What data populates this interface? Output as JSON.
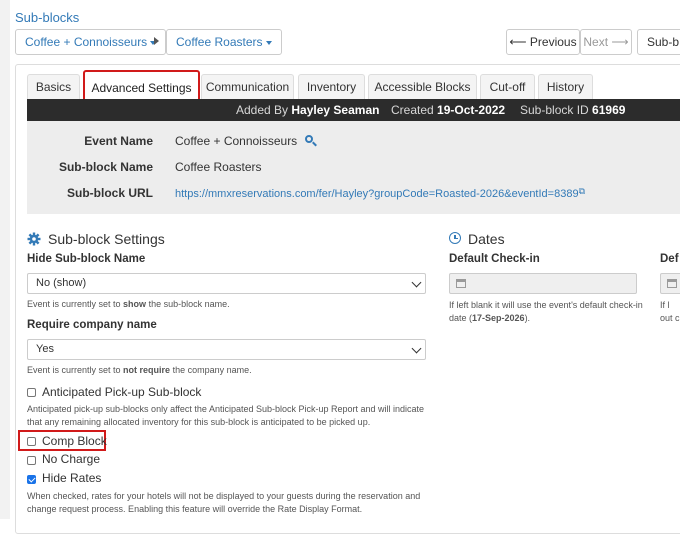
{
  "page": {
    "title": "Sub-blocks"
  },
  "breadcrumb": {
    "event": "Coffee + Connoisseurs",
    "subblock": "Coffee Roasters"
  },
  "nav": {
    "previous": "Previous",
    "next": "Next",
    "subblock_more": "Sub-b"
  },
  "tabs": [
    {
      "label": "Basics"
    },
    {
      "label": "Advanced Settings"
    },
    {
      "label": "Communication"
    },
    {
      "label": "Inventory"
    },
    {
      "label": "Accessible Blocks"
    },
    {
      "label": "Cut-off"
    },
    {
      "label": "History"
    }
  ],
  "meta": {
    "added_by_label": "Added By",
    "added_by": "Hayley Seaman",
    "created_label": "Created",
    "created": "19-Oct-2022",
    "id_label": "Sub-block ID",
    "id": "61969"
  },
  "info": {
    "event_name_label": "Event Name",
    "event_name": "Coffee + Connoisseurs",
    "subblock_name_label": "Sub-block Name",
    "subblock_name": "Coffee Roasters",
    "subblock_url_label": "Sub-block URL",
    "subblock_url": "https://mmxreservations.com/fer/Hayley?groupCode=Roasted-2026&eventId=8389"
  },
  "settings": {
    "heading": "Sub-block Settings",
    "hide_name_label": "Hide Sub-block Name",
    "hide_name_value": "No (show)",
    "hide_name_help_pre": "Event is currently set to ",
    "hide_name_help_bold": "show",
    "hide_name_help_post": " the sub-block name.",
    "require_company_label": "Require company name",
    "require_company_value": "Yes",
    "require_company_help_pre": "Event is currently set to ",
    "require_company_help_bold": "not require",
    "require_company_help_post": " the company name.",
    "anticipated_label": "Anticipated Pick-up Sub-block",
    "anticipated_help": "Anticipated pick-up sub-blocks only affect the Anticipated Sub-block Pick-up Report and will indicate that any remaining allocated inventory for this sub-block is anticipated to be picked up.",
    "comp_block_label": "Comp Block",
    "no_charge_label": "No Charge",
    "hide_rates_label": "Hide Rates",
    "hide_rates_help": "When checked, rates for your hotels will not be displayed to your guests during the reservation and change request process. Enabling this feature will override the Rate Display Format."
  },
  "dates": {
    "heading": "Dates",
    "checkin_label": "Default Check-in",
    "checkin_help_pre": "If left blank it will use the event's default check-in date (",
    "checkin_help_bold": "17-Sep-2026",
    "checkin_help_post": ").",
    "checkout_label_partial": "Def",
    "checkout_help_partial_1": "If l",
    "checkout_help_partial_2": "out c"
  },
  "colors": {
    "accent": "#337ab7",
    "highlight": "#d11a1a",
    "darkbar": "#2c2c2c"
  }
}
